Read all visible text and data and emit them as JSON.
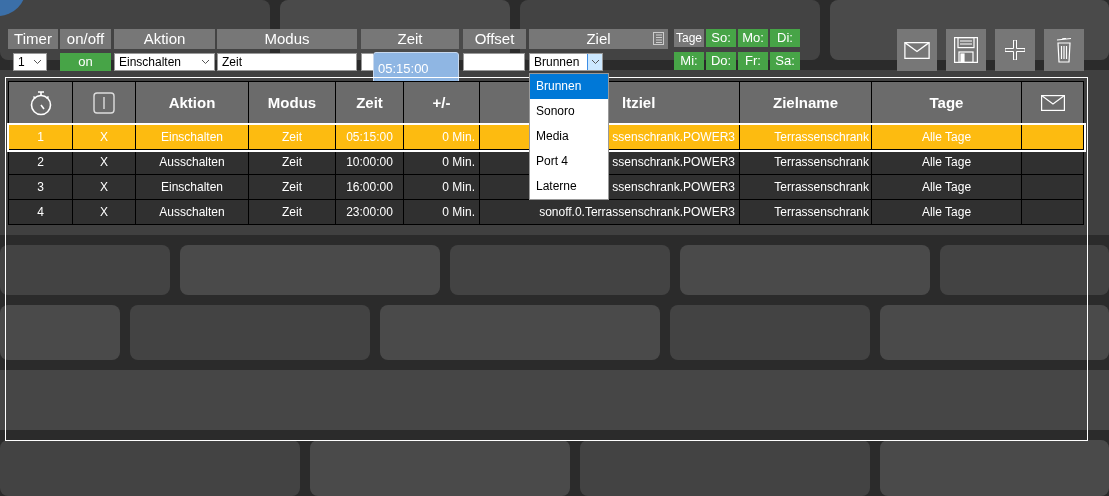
{
  "filters": [
    {
      "header": "Timer",
      "kind": "select",
      "value": "1"
    },
    {
      "header": "on/off",
      "kind": "toggle",
      "value": "on",
      "on": true
    },
    {
      "header": "Aktion",
      "kind": "select",
      "value": "Einschalten"
    },
    {
      "header": "Modus",
      "kind": "text",
      "value": "Zeit"
    },
    {
      "header": "Zeit",
      "kind": "time",
      "value": "05:15:00"
    },
    {
      "header": "Offset",
      "kind": "text"
    },
    {
      "header": "Ziel",
      "kind": "select",
      "value": "Brunnen",
      "expanded": true,
      "options": [
        {
          "label": "Brunnen",
          "selected": true
        },
        {
          "label": "Sonoro",
          "selected": false
        },
        {
          "label": "Media",
          "selected": false
        },
        {
          "label": "Port 4",
          "selected": false
        },
        {
          "label": "Laterne",
          "selected": false
        }
      ]
    }
  ],
  "days": {
    "label": "Tage",
    "items": [
      {
        "label": "So:",
        "on": true
      },
      {
        "label": "Mo:",
        "on": true
      },
      {
        "label": "Di:",
        "on": true
      },
      {
        "label": "Mi:",
        "on": true
      },
      {
        "label": "Do:",
        "on": true
      },
      {
        "label": "Fr:",
        "on": true
      },
      {
        "label": "Sa:",
        "on": true
      }
    ]
  },
  "table": {
    "columns": [
      {
        "kind": "stopwatch"
      },
      {
        "kind": "switch"
      },
      {
        "kind": "text",
        "label": "Aktion"
      },
      {
        "kind": "text",
        "label": "Modus"
      },
      {
        "kind": "text",
        "label": "Zeit"
      },
      {
        "kind": "text",
        "label": "+/-"
      },
      {
        "kind": "text",
        "label": "ltziel"
      },
      {
        "kind": "text",
        "label": "Zielname"
      },
      {
        "kind": "text",
        "label": "Tage"
      },
      {
        "kind": "mail"
      }
    ],
    "rows": [
      {
        "selected": true,
        "cells": [
          "1",
          "X",
          "Einschalten",
          "Zeit",
          "05:15:00",
          "0 Min.",
          "ssenschrank.POWER3",
          "Terrassenschrank",
          "Alle Tage"
        ]
      },
      {
        "selected": false,
        "cells": [
          "2",
          "X",
          "Ausschalten",
          "Zeit",
          "10:00:00",
          "0 Min.",
          "ssenschrank.POWER3",
          "Terrassenschrank",
          "Alle Tage"
        ]
      },
      {
        "selected": false,
        "cells": [
          "3",
          "X",
          "Einschalten",
          "Zeit",
          "16:00:00",
          "0 Min.",
          "ssenschrank.POWER3",
          "Terrassenschrank",
          "Alle Tage"
        ]
      },
      {
        "selected": false,
        "cells": [
          "4",
          "X",
          "Ausschalten",
          "Zeit",
          "23:00:00",
          "0 Min.",
          "sonoff.0.Terrassenschrank.POWER3",
          "Terrassenschrank",
          "Alle Tage"
        ]
      }
    ]
  }
}
